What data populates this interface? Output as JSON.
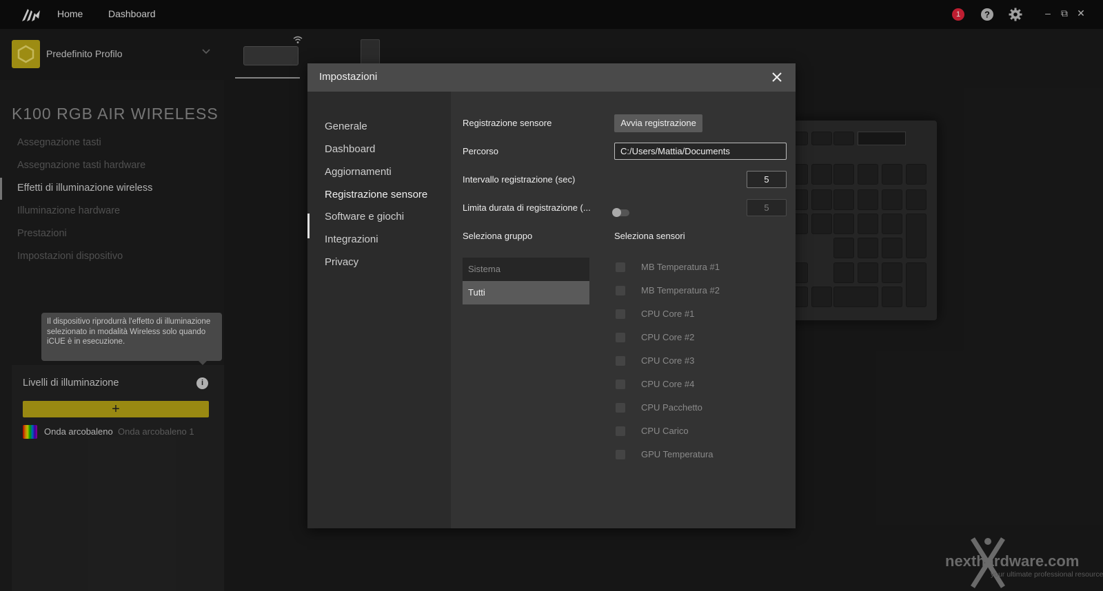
{
  "topbar": {
    "nav": [
      "Home",
      "Dashboard"
    ],
    "notification_count": "1",
    "icons": [
      "corsair-logo-icon",
      "notification-icon",
      "help-icon",
      "settings-icon",
      "minimize-icon",
      "restore-icon",
      "close-icon"
    ]
  },
  "profile": {
    "name": "Predefinito Profilo"
  },
  "device": {
    "title": "K100 RGB AIR WIRELESS",
    "menu": [
      "Assegnazione tasti",
      "Assegnazione tasti hardware",
      "Effetti di illuminazione wireless",
      "Illuminazione hardware",
      "Prestazioni",
      "Impostazioni dispositivo"
    ],
    "active_menu_index": 2
  },
  "lighting": {
    "tooltip": "Il dispositivo riprodurrà l'effetto di illuminazione selezionato in modalità Wireless solo quando iCUE è in esecuzione.",
    "title": "Livelli di illuminazione",
    "add_label": "+",
    "layer_name": "Onda arcobaleno",
    "layer_sub": "Onda arcobaleno 1"
  },
  "modal": {
    "title": "Impostazioni",
    "nav": [
      "Generale",
      "Dashboard",
      "Aggiornamenti",
      "Registrazione sensore",
      "Software e giochi",
      "Integrazioni",
      "Privacy"
    ],
    "active_nav_index": 3,
    "sensor_recording_label": "Registrazione sensore",
    "start_recording_button": "Avvia registrazione",
    "path_label": "Percorso",
    "path_value": "C:/Users/Mattia/Documents",
    "interval_label": "Intervallo registrazione (sec)",
    "interval_value": "5",
    "limit_label": "Limita durata di registrazione (...",
    "limit_enabled": false,
    "limit_value": "5",
    "group_label": "Seleziona gruppo",
    "sensors_label": "Seleziona sensori",
    "groups": [
      "Sistema",
      "Tutti"
    ],
    "selected_group_index": 1,
    "sensors": [
      "MB Temperatura #1",
      "MB Temperatura #2",
      "CPU Core #1",
      "CPU Core #2",
      "CPU Core #3",
      "CPU Core #4",
      "CPU Pacchetto",
      "CPU Carico",
      "GPU Temperatura"
    ]
  },
  "watermark": {
    "brand": "nexthardware.com",
    "tagline": "your ultimate professional resource"
  },
  "colors": {
    "accent": "#b4a216",
    "notification": "#e0243a",
    "modal_header": "#4a4a4a"
  }
}
